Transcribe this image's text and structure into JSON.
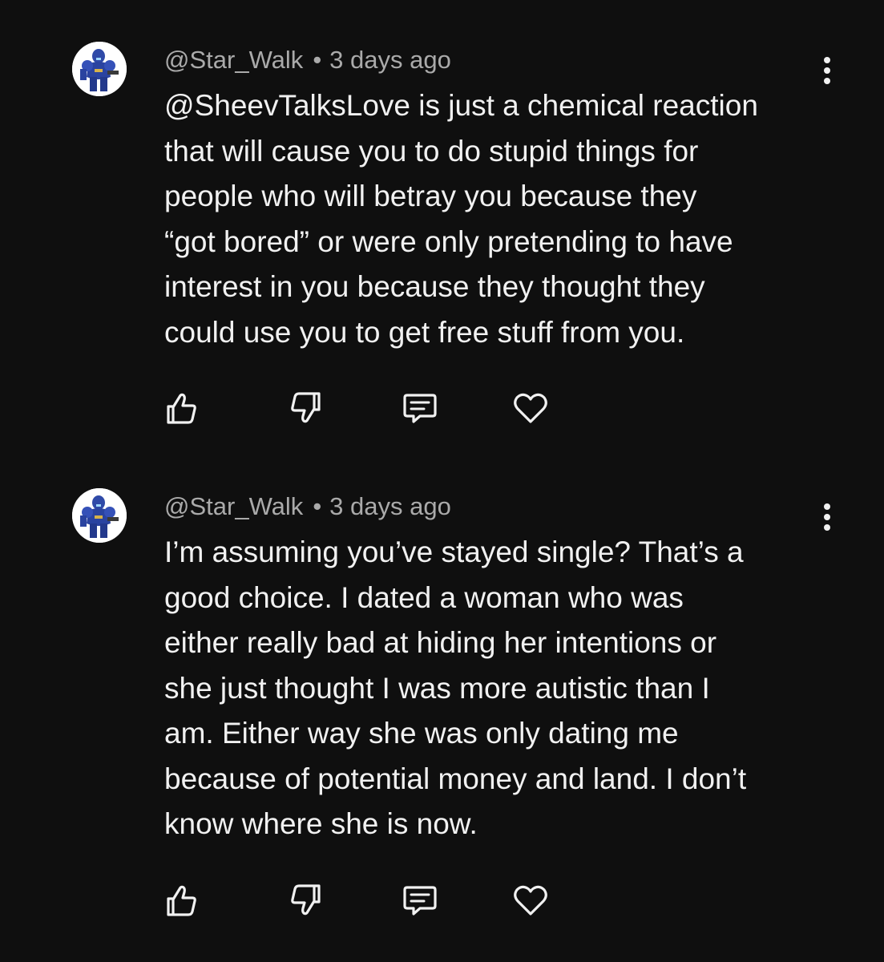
{
  "comments": [
    {
      "author": "@Star_Walk",
      "separator": "•",
      "time": "3 days ago",
      "text": "@SheevTalksLove is just a chemical reaction\nthat will cause you to do stupid things for\npeople who will betray you because they\n“got bored” or were only pretending to have\ninterest in you because they thought they\ncould use you to get free stuff from you.",
      "avatar_icon": "armored-soldier-avatar-icon",
      "more_icon": "more-vertical-icon",
      "actions": [
        "thumbs-up-icon",
        "thumbs-down-icon",
        "reply-icon",
        "heart-icon"
      ]
    },
    {
      "author": "@Star_Walk",
      "separator": "•",
      "time": "3 days ago",
      "text": "I’m assuming you’ve stayed single? That’s a\ngood choice. I dated a woman who was\neither really bad at hiding her intentions or\nshe just thought I was more autistic than I\nam. Either way she was only dating me\nbecause of potential money and land. I don’t\nknow where she is now.",
      "avatar_icon": "armored-soldier-avatar-icon",
      "more_icon": "more-vertical-icon",
      "actions": [
        "thumbs-up-icon",
        "thumbs-down-icon",
        "reply-icon",
        "heart-icon"
      ]
    }
  ],
  "colors": {
    "background": "#0f0f0f",
    "text": "#f1f1f1",
    "meta": "#aaaaaa",
    "avatar_bg": "#ffffff",
    "avatar_armor": "#2f4aa8"
  }
}
